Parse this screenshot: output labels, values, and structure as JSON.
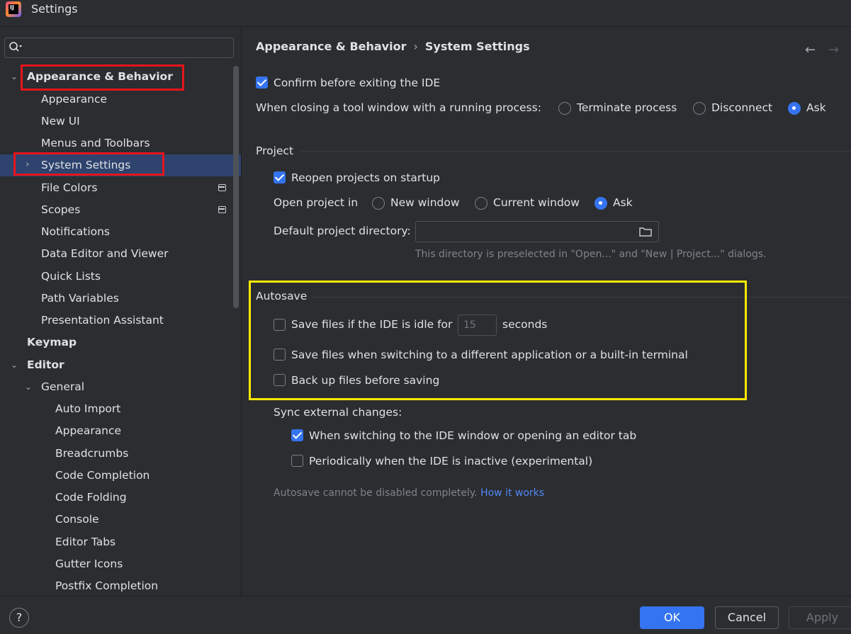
{
  "window": {
    "title": "Settings",
    "app_icon": "intellij-idea-icon"
  },
  "sidebar": {
    "search": {
      "placeholder": "",
      "icon": "search-icon"
    },
    "items": [
      {
        "label": "Appearance & Behavior",
        "level": 0,
        "expanded": true,
        "bold": true
      },
      {
        "label": "Appearance",
        "level": 1
      },
      {
        "label": "New UI",
        "level": 1
      },
      {
        "label": "Menus and Toolbars",
        "level": 1
      },
      {
        "label": "System Settings",
        "level": 1,
        "selected": true,
        "collapsed": true
      },
      {
        "label": "File Colors",
        "level": 1,
        "project_icon": true
      },
      {
        "label": "Scopes",
        "level": 1,
        "project_icon": true
      },
      {
        "label": "Notifications",
        "level": 1
      },
      {
        "label": "Data Editor and Viewer",
        "level": 1
      },
      {
        "label": "Quick Lists",
        "level": 1
      },
      {
        "label": "Path Variables",
        "level": 1
      },
      {
        "label": "Presentation Assistant",
        "level": 1
      },
      {
        "label": "Keymap",
        "level": 0,
        "bold": true
      },
      {
        "label": "Editor",
        "level": 0,
        "expanded": true,
        "bold": true
      },
      {
        "label": "General",
        "level": 1,
        "expanded": true
      },
      {
        "label": "Auto Import",
        "level": 2
      },
      {
        "label": "Appearance",
        "level": 2
      },
      {
        "label": "Breadcrumbs",
        "level": 2
      },
      {
        "label": "Code Completion",
        "level": 2
      },
      {
        "label": "Code Folding",
        "level": 2
      },
      {
        "label": "Console",
        "level": 2
      },
      {
        "label": "Editor Tabs",
        "level": 2
      },
      {
        "label": "Gutter Icons",
        "level": 2
      },
      {
        "label": "Postfix Completion",
        "level": 2
      }
    ]
  },
  "content": {
    "breadcrumb": {
      "parent": "Appearance & Behavior",
      "separator": "›",
      "current": "System Settings"
    },
    "nav": {
      "back": "←",
      "forward": "→"
    },
    "confirm_exit": {
      "label": "Confirm before exiting the IDE",
      "checked": true
    },
    "tool_window": {
      "label": "When closing a tool window with a running process:",
      "options": [
        "Terminate process",
        "Disconnect",
        "Ask"
      ],
      "selected": "Ask"
    },
    "project": {
      "title": "Project",
      "reopen": {
        "label": "Reopen projects on startup",
        "checked": true
      },
      "open_in": {
        "label": "Open project in",
        "options": [
          "New window",
          "Current window",
          "Ask"
        ],
        "selected": "Ask"
      },
      "default_dir": {
        "label": "Default project directory:",
        "value": "",
        "hint": "This directory is preselected in \"Open...\" and \"New | Project...\" dialogs."
      }
    },
    "autosave": {
      "title": "Autosave",
      "idle": {
        "label_before": "Save files if the IDE is idle for",
        "value": "15",
        "label_after": "seconds",
        "checked": false
      },
      "switching": {
        "label": "Save files when switching to a different application or a built-in terminal",
        "checked": false
      },
      "backup": {
        "label": "Back up files before saving",
        "checked": false
      }
    },
    "sync": {
      "label": "Sync external changes:",
      "switching": {
        "label": "When switching to the IDE window or opening an editor tab",
        "checked": true
      },
      "periodic": {
        "label": "Periodically when the IDE is inactive (experimental)",
        "checked": false
      }
    },
    "note": {
      "text": "Autosave cannot be disabled completely.",
      "link": "How it works"
    }
  },
  "footer": {
    "help": "?",
    "ok": "OK",
    "cancel": "Cancel",
    "apply": "Apply"
  },
  "colors": {
    "background": "#2b2d30",
    "selection": "#2e436e",
    "accent": "#3574f0",
    "highlight_red": "#e8141c",
    "highlight_yellow": "#ffea00",
    "link": "#548af7"
  }
}
